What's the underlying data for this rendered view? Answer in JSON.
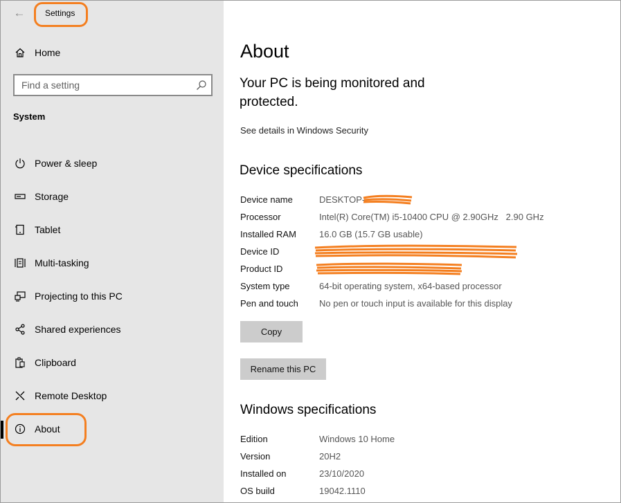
{
  "window": {
    "title": "Settings",
    "back_glyph": "←"
  },
  "sidebar": {
    "home_label": "Home",
    "search_placeholder": "Find a setting",
    "section_title": "System",
    "items": [
      {
        "label": "Power & sleep",
        "icon": "power-icon"
      },
      {
        "label": "Storage",
        "icon": "storage-icon"
      },
      {
        "label": "Tablet",
        "icon": "tablet-icon"
      },
      {
        "label": "Multi-tasking",
        "icon": "multitasking-icon"
      },
      {
        "label": "Projecting to this PC",
        "icon": "projecting-icon"
      },
      {
        "label": "Shared experiences",
        "icon": "shared-experiences-icon"
      },
      {
        "label": "Clipboard",
        "icon": "clipboard-icon"
      },
      {
        "label": "Remote Desktop",
        "icon": "remote-desktop-icon"
      },
      {
        "label": "About",
        "icon": "info-icon",
        "active": true
      }
    ]
  },
  "main": {
    "title": "About",
    "protection": "Your PC is being monitored and protected.",
    "security_link": "See details in Windows Security",
    "device_specs": {
      "heading": "Device specifications",
      "rows": [
        {
          "key": "Device name",
          "value": "DESKTOP-"
        },
        {
          "key": "Processor",
          "value": "Intel(R) Core(TM) i5-10400 CPU @ 2.90GHz   2.90 GHz"
        },
        {
          "key": "Installed RAM",
          "value": "16.0 GB (15.7 GB usable)"
        },
        {
          "key": "Device ID",
          "value": ""
        },
        {
          "key": "Product ID",
          "value": ""
        },
        {
          "key": "System type",
          "value": "64-bit operating system, x64-based processor"
        },
        {
          "key": "Pen and touch",
          "value": "No pen or touch input is available for this display"
        }
      ],
      "copy_button": "Copy",
      "rename_button": "Rename this PC"
    },
    "windows_specs": {
      "heading": "Windows specifications",
      "rows": [
        {
          "key": "Edition",
          "value": "Windows 10 Home"
        },
        {
          "key": "Version",
          "value": "20H2"
        },
        {
          "key": "Installed on",
          "value": "23/10/2020"
        },
        {
          "key": "OS build",
          "value": "19042.1110"
        }
      ]
    }
  },
  "colors": {
    "annotation": "#f47f20",
    "sidebar_bg": "#e6e6e6",
    "button_bg": "#cccccc"
  }
}
